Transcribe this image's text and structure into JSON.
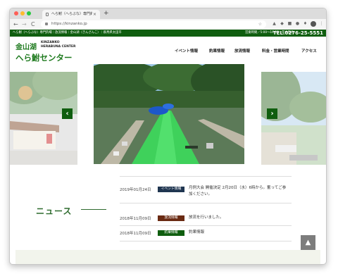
{
  "browser": {
    "tab_title": "へら鮒（へらぶな）専門釣場・金山…",
    "tab_close": "×",
    "new_tab": "+",
    "url": "https://kinzanko.jp",
    "back": "←",
    "forward": "→",
    "reload": "C",
    "star": "☆"
  },
  "site_bar": {
    "left_text": "へら鮒（へらぶな）専門釣場｜放流情報｜金山湖（きんざんこ）｜群馬県太田市",
    "hours_text": "営業時間／5:00〜16:00　年中無休",
    "tel": "TEL.0276-25-5551"
  },
  "logo": {
    "jp_top": "金山湖",
    "en": "KINZANKO\nHERABUNA CENTER",
    "jp_bottom": "へら鮒センター"
  },
  "nav": {
    "items": [
      "イベント情報",
      "釣果情報",
      "放流情報",
      "料金・営業時間",
      "アクセス"
    ]
  },
  "slider": {
    "prev": "‹",
    "next": "›"
  },
  "news": {
    "heading": "ニュース",
    "items": [
      {
        "date": "2019年01月24日",
        "category": "イベント情報",
        "text": "月例大会 開催決定 2月20日（水）6時から。奮ってご参加ください。",
        "color": "#1f3550"
      },
      {
        "date": "2018年11月09日",
        "category": "放流情報",
        "text": "放流を行いました。",
        "color": "#6a2a12"
      },
      {
        "date": "2018年11月09日",
        "category": "釣果情報",
        "text": "釣果情報",
        "color": "#0f5e0f"
      }
    ]
  },
  "page_top": "▲",
  "colors": {
    "brand_green": "#0f5e0f",
    "logo_green": "#1e7a1e"
  }
}
